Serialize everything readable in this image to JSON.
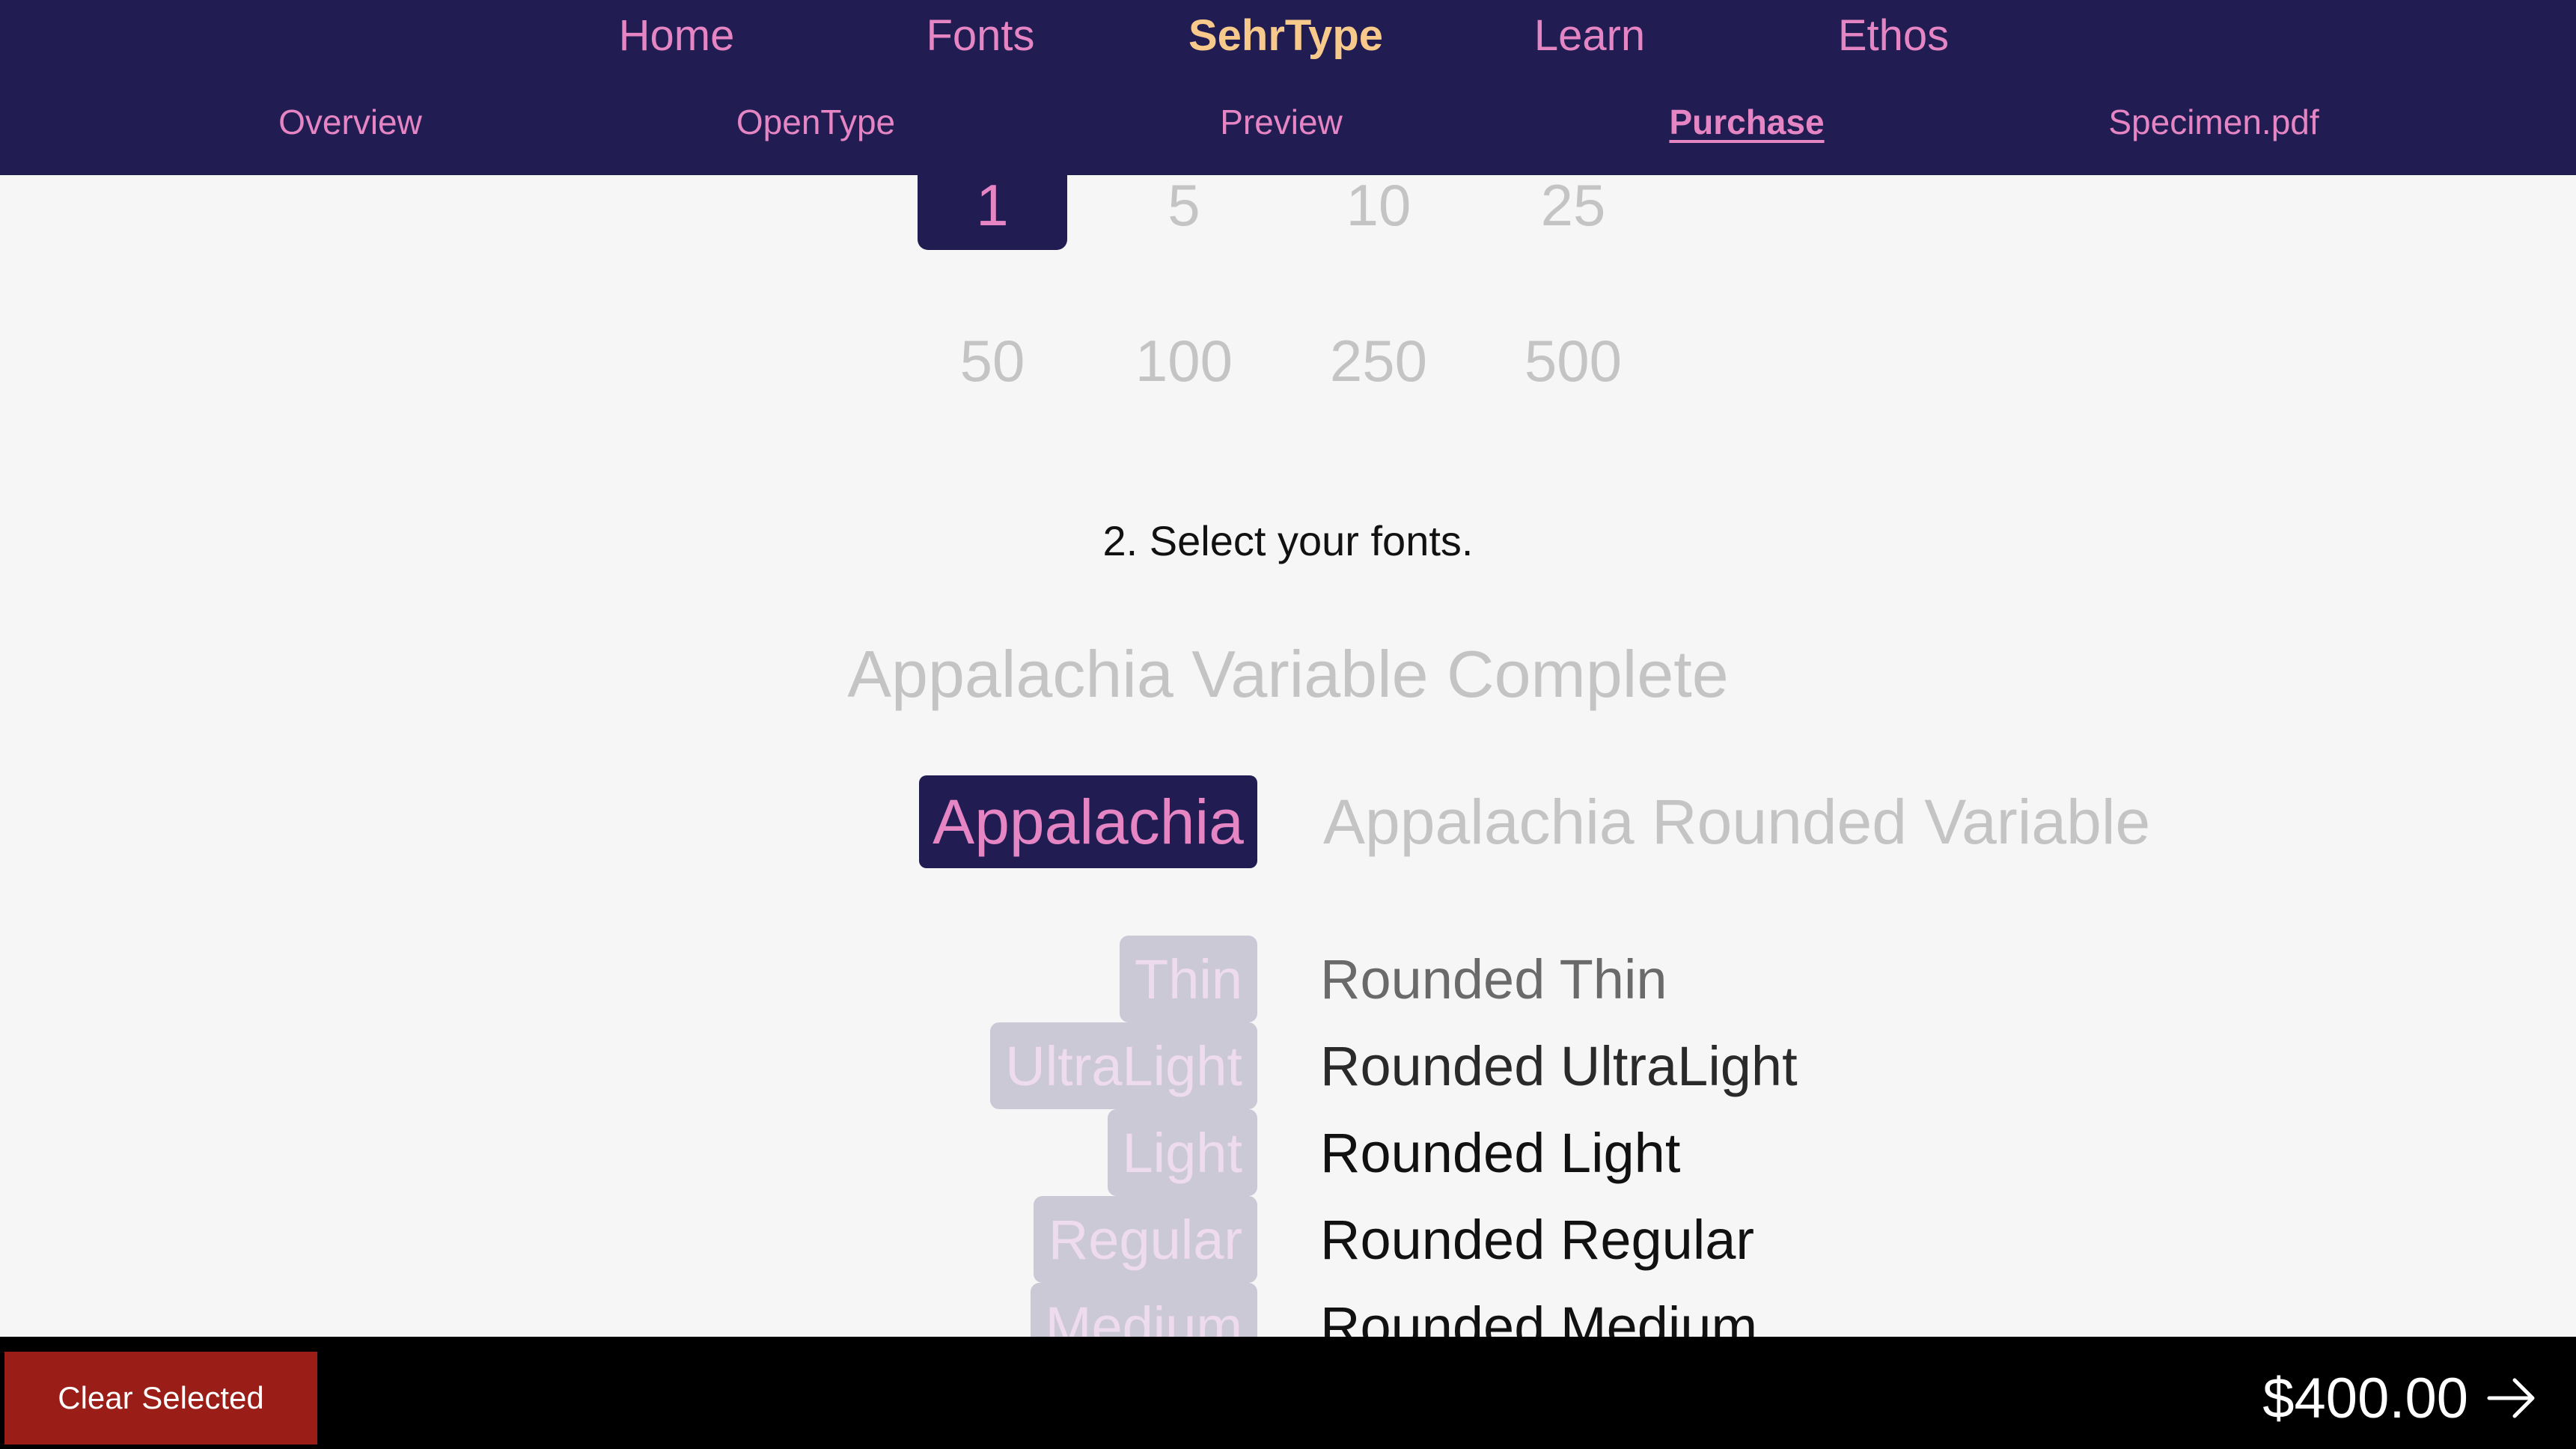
{
  "nav": {
    "main": [
      "Home",
      "Fonts",
      "SehrType",
      "Learn",
      "Ethos"
    ],
    "sub": [
      "Overview",
      "OpenType",
      "Preview",
      "Purchase",
      "Specimen.pdf"
    ]
  },
  "quantities": {
    "row1": [
      "1",
      "5",
      "10",
      "25"
    ],
    "row2": [
      "50",
      "100",
      "250",
      "500"
    ]
  },
  "section_title": "2. Select your fonts.",
  "families": {
    "complete": "Appalachia Variable Complete",
    "appalachia": "Appalachia",
    "rounded": "Appalachia Rounded Variable"
  },
  "weights_left": [
    "Thin",
    "UltraLight",
    "Light",
    "Regular",
    "Medium"
  ],
  "weights_right": [
    "Rounded Thin",
    "Rounded UltraLight",
    "Rounded Light",
    "Rounded Regular",
    "Rounded Medium"
  ],
  "footer": {
    "clear_label": "Clear Selected",
    "total": "$400.00"
  },
  "colors": {
    "header_bg": "#211d52",
    "accent_pink": "#e685c4",
    "accent_gold": "#f7c98b",
    "clear_button": "#9a1e17"
  }
}
